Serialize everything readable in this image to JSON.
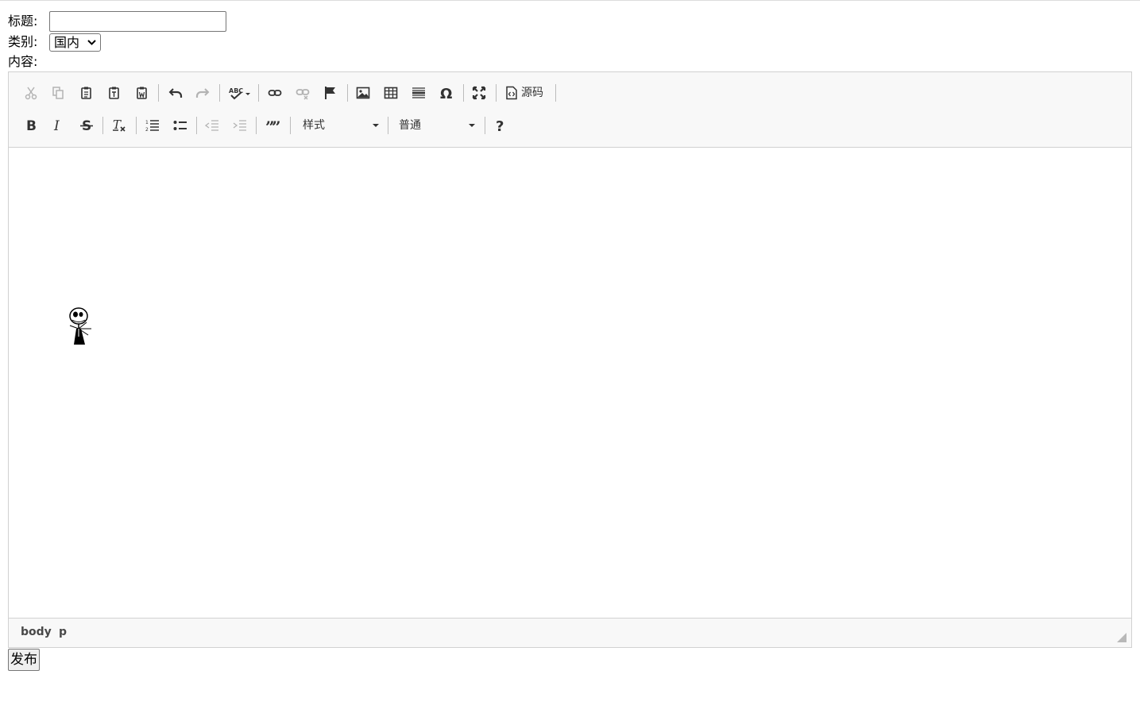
{
  "form": {
    "title_label": "标题:",
    "title_value": "",
    "category_label": "类别:",
    "category_selected": "国内",
    "content_label": "内容:"
  },
  "editor": {
    "toolbar": {
      "row1": [
        {
          "icon": "cut-icon",
          "enabled": false
        },
        {
          "icon": "copy-icon",
          "enabled": false
        },
        {
          "icon": "paste-icon",
          "enabled": true
        },
        {
          "icon": "paste-text-icon",
          "enabled": true
        },
        {
          "icon": "paste-word-icon",
          "enabled": true
        },
        {
          "icon": "undo-icon",
          "enabled": true
        },
        {
          "icon": "redo-icon",
          "enabled": false
        },
        {
          "icon": "spellcheck-icon",
          "enabled": true
        },
        {
          "icon": "link-icon",
          "enabled": true
        },
        {
          "icon": "unlink-icon",
          "enabled": false
        },
        {
          "icon": "anchor-flag-icon",
          "enabled": true
        },
        {
          "icon": "image-icon",
          "enabled": true
        },
        {
          "icon": "table-icon",
          "enabled": true
        },
        {
          "icon": "horizontal-line-icon",
          "enabled": true
        },
        {
          "icon": "special-char-icon",
          "enabled": true
        },
        {
          "icon": "maximize-icon",
          "enabled": true
        }
      ],
      "source_label": "源码",
      "row2": [
        {
          "icon": "bold-icon",
          "enabled": true
        },
        {
          "icon": "italic-icon",
          "enabled": true
        },
        {
          "icon": "strike-icon",
          "enabled": true
        },
        {
          "icon": "remove-format-icon",
          "enabled": true
        },
        {
          "icon": "numbered-list-icon",
          "enabled": true
        },
        {
          "icon": "bulleted-list-icon",
          "enabled": true
        },
        {
          "icon": "outdent-icon",
          "enabled": false
        },
        {
          "icon": "indent-icon",
          "enabled": false
        },
        {
          "icon": "blockquote-icon",
          "enabled": true
        },
        {
          "icon": "help-icon",
          "enabled": true
        }
      ],
      "styles_label": "样式",
      "format_label": "普通"
    },
    "content": {
      "image": "skeleton-figure-image"
    },
    "status_path": [
      "body",
      "p"
    ]
  },
  "publish_label": "发布",
  "colors": {
    "toolbar_bg": "#f8f8f8",
    "border": "#d1d1d1",
    "icon": "#333333",
    "icon_disabled": "#b3b3b3"
  }
}
